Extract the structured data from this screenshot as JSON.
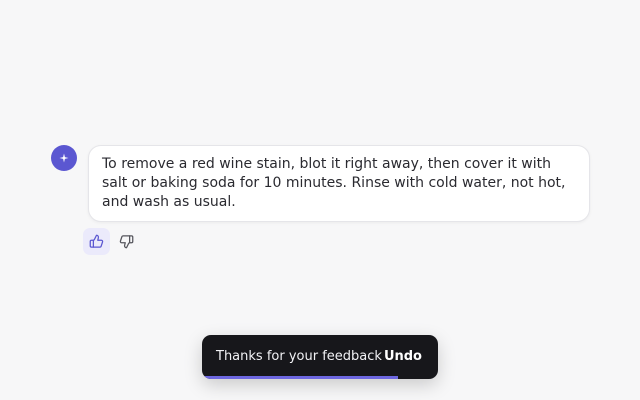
{
  "message": {
    "text": "To remove a red wine stain, blot it right away, then cover it with salt or baking soda for 10 minutes. Rinse with cold water, not hot, and wash as usual."
  },
  "avatar": {
    "icon": "sparkle-icon",
    "color": "#5b57d1"
  },
  "feedback": {
    "thumbs_up": {
      "icon": "thumbs-up-icon",
      "selected": true
    },
    "thumbs_down": {
      "icon": "thumbs-down-icon",
      "selected": false
    }
  },
  "toast": {
    "message": "Thanks for your feedback",
    "action_label": "Undo",
    "progress_fraction": 0.83,
    "accent_color": "#6d67e0"
  }
}
